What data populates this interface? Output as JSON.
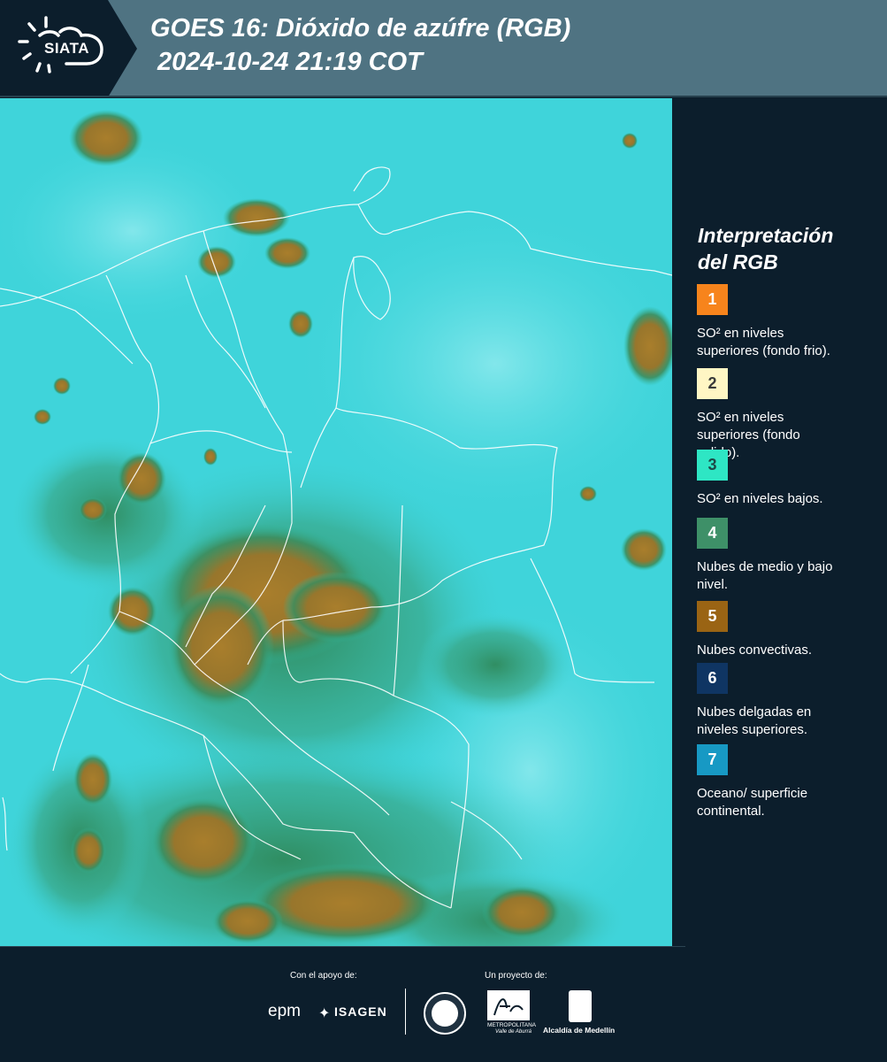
{
  "header": {
    "logo_text": "SIATA",
    "title_line1": "GOES 16: Dióxido de azúfre (RGB)",
    "title_line2": "2024-10-24 21:19 COT"
  },
  "legend": {
    "title_line1": "Interpretación",
    "title_line2": "del RGB",
    "items": [
      {
        "number": "1",
        "color": "#f7841c",
        "text_color": "#ffffff",
        "line1": "SO² en niveles",
        "line2": "superiores (fondo frio)."
      },
      {
        "number": "2",
        "color": "#fff6c4",
        "text_color": "#3a3a3a",
        "line1": "SO² en niveles",
        "line2": "superiores (fondo",
        "line3": "calido)."
      },
      {
        "number": "3",
        "color": "#2ee6c4",
        "text_color": "#1d4a48",
        "line1": "SO² en niveles bajos."
      },
      {
        "number": "4",
        "color": "#3e9068",
        "text_color": "#ffffff",
        "line1": "Nubes de medio y bajo",
        "line2": "nivel."
      },
      {
        "number": "5",
        "color": "#9a6414",
        "text_color": "#ffffff",
        "line1": "Nubes convectivas."
      },
      {
        "number": "6",
        "color": "#0f3563",
        "text_color": "#ffffff",
        "line1": "Nubes delgadas en",
        "line2": "niveles superiores."
      },
      {
        "number": "7",
        "color": "#1799c4",
        "text_color": "#ffffff",
        "line1": "Oceano/ superficie",
        "line2": "continental."
      }
    ]
  },
  "footer": {
    "support_label": "Con el apoyo de:",
    "project_label": "Un proyecto de:",
    "sponsor1": "epm",
    "sponsor2": "ISAGEN",
    "sponsor3_line1": "METROPOLITANA",
    "sponsor3_line2": "Valle de Aburrá",
    "sponsor4": "Alcaldía de Medellín"
  }
}
